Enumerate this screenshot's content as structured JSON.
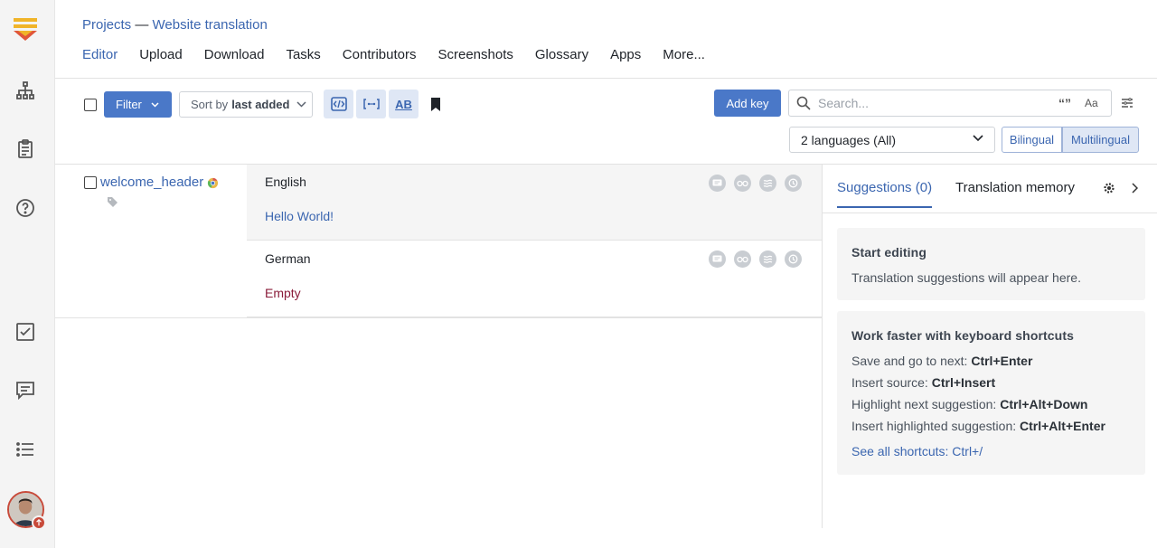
{
  "breadcrumb": {
    "projects": "Projects",
    "separator": "—",
    "project": "Website translation"
  },
  "nav": {
    "tabs": [
      {
        "label": "Editor",
        "active": true
      },
      {
        "label": "Upload"
      },
      {
        "label": "Download"
      },
      {
        "label": "Tasks"
      },
      {
        "label": "Contributors"
      },
      {
        "label": "Screenshots"
      },
      {
        "label": "Glossary"
      },
      {
        "label": "Apps"
      },
      {
        "label": "More..."
      }
    ]
  },
  "toolbar": {
    "filter_label": "Filter",
    "sort_prefix": "Sort by",
    "sort_value": "last added",
    "add_key_label": "Add key",
    "search_placeholder": "Search...",
    "search_exact_label": "“”",
    "search_case_label": "Aa",
    "ab_label": "AB",
    "languages_select": "2 languages (All)",
    "view_bilingual": "Bilingual",
    "view_multilingual": "Multilingual"
  },
  "key": {
    "name": "welcome_header",
    "translations": [
      {
        "language": "English",
        "text": "Hello World!",
        "text_color": "#3b66b0"
      },
      {
        "language": "German",
        "text": "Empty",
        "text_color": "#8a1c3a"
      }
    ]
  },
  "panel": {
    "tabs": [
      {
        "label": "Suggestions (0)",
        "active": true
      },
      {
        "label": "Translation memory"
      }
    ],
    "start_card": {
      "title": "Start editing",
      "text": "Translation suggestions will appear here."
    },
    "shortcuts_card": {
      "title": "Work faster with keyboard shortcuts",
      "items": [
        {
          "label": "Save and go to next:",
          "keys": "Ctrl+Enter"
        },
        {
          "label": "Insert source:",
          "keys": "Ctrl+Insert"
        },
        {
          "label": "Highlight next suggestion:",
          "keys": "Ctrl+Alt+Down"
        },
        {
          "label": "Insert highlighted suggestion:",
          "keys": "Ctrl+Alt+Enter"
        }
      ],
      "link": "See all shortcuts: Ctrl+/"
    }
  },
  "colors": {
    "accent": "#4a78c8",
    "link": "#3b66b0",
    "empty": "#8a1c3a"
  }
}
